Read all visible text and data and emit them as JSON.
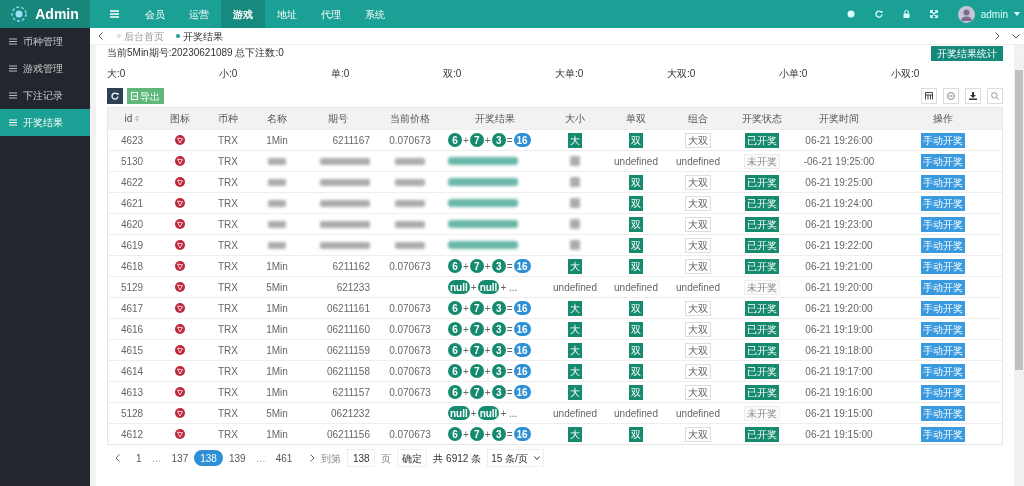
{
  "brand": "Admin",
  "nav": [
    {
      "label": "会员",
      "selected": false
    },
    {
      "label": "运营",
      "selected": false
    },
    {
      "label": "游戏",
      "selected": true
    },
    {
      "label": "地址",
      "selected": false
    },
    {
      "label": "代理",
      "selected": false
    },
    {
      "label": "系统",
      "selected": false
    }
  ],
  "user": "admin",
  "sidebar": [
    {
      "label": "币种管理",
      "selected": false
    },
    {
      "label": "游戏管理",
      "selected": false
    },
    {
      "label": "下注记录",
      "selected": false
    },
    {
      "label": "开奖结果",
      "selected": true
    }
  ],
  "tabs": [
    {
      "label": "后台首页",
      "selected": false
    },
    {
      "label": "开奖结果",
      "selected": true
    }
  ],
  "info": "当前5Min期号:20230621089 总下注数:0",
  "top_button": "开奖结果统计",
  "stats": [
    "大:0",
    "小:0",
    "单:0",
    "双:0",
    "大单:0",
    "大双:0",
    "小单:0",
    "小双:0"
  ],
  "export_button": "导出",
  "table": {
    "columns": [
      "id",
      "图标",
      "币种",
      "名称",
      "期号",
      "当前价格",
      "开奖结果",
      "大小",
      "单双",
      "组合",
      "开奖状态",
      "开奖时间",
      "操作"
    ],
    "rows": [
      {
        "kind": "drawn",
        "id": "4623",
        "coin": "TRX",
        "name": "1Min",
        "period": "6211167",
        "price": "0.070673",
        "result": [
          {
            "kind": "ball",
            "t": "6"
          },
          {
            "kind": "op",
            "t": "+"
          },
          {
            "kind": "ball",
            "t": "7"
          },
          {
            "kind": "op",
            "t": "+"
          },
          {
            "kind": "ball",
            "t": "3"
          },
          {
            "kind": "op",
            "t": "="
          },
          {
            "kind": "sum",
            "t": "16"
          }
        ],
        "size": "大",
        "parity": "双",
        "combo": "大双",
        "status": "已开奖",
        "time": "06-21 19:26:00",
        "action": "手动开奖"
      },
      {
        "kind": "pending",
        "redacted": true,
        "id": "5130",
        "coin": "TRX",
        "parity": "undefined",
        "combo": "undefined",
        "status": "未开奖",
        "time": "-06-21 19:25:00",
        "action": "手动开奖"
      },
      {
        "kind": "drawn",
        "redacted": true,
        "id": "4622",
        "coin": "TRX",
        "parity": "双",
        "combo": "大双",
        "status": "已开奖",
        "time": "06-21 19:25:00",
        "action": "手动开奖"
      },
      {
        "kind": "drawn",
        "redacted": true,
        "id": "4621",
        "coin": "TRX",
        "parity": "双",
        "combo": "大双",
        "status": "已开奖",
        "time": "06-21 19:24:00",
        "action": "手动开奖"
      },
      {
        "kind": "drawn",
        "redacted": true,
        "id": "4620",
        "coin": "TRX",
        "parity": "双",
        "combo": "大双",
        "status": "已开奖",
        "time": "06-21 19:23:00",
        "action": "手动开奖"
      },
      {
        "kind": "drawn",
        "redacted": true,
        "id": "4619",
        "coin": "TRX",
        "parity": "双",
        "combo": "大双",
        "status": "已开奖",
        "time": "06-21 19:22:00",
        "action": "手动开奖"
      },
      {
        "kind": "drawn",
        "id": "4618",
        "coin": "TRX",
        "name": "1Min",
        "period": "6211162",
        "price": "0.070673",
        "result": [
          {
            "kind": "ball",
            "t": "6"
          },
          {
            "kind": "op",
            "t": "+"
          },
          {
            "kind": "ball",
            "t": "7"
          },
          {
            "kind": "op",
            "t": "+"
          },
          {
            "kind": "ball",
            "t": "3"
          },
          {
            "kind": "op",
            "t": "="
          },
          {
            "kind": "sum",
            "t": "16"
          }
        ],
        "size": "大",
        "parity": "双",
        "combo": "大双",
        "status": "已开奖",
        "time": "06-21 19:21:00",
        "action": "手动开奖"
      },
      {
        "kind": "pending",
        "id": "5129",
        "coin": "TRX",
        "name": "5Min",
        "period": "621233",
        "result": [
          {
            "kind": "ball",
            "t": "null"
          },
          {
            "kind": "op",
            "t": "+"
          },
          {
            "kind": "ball",
            "t": "null"
          },
          {
            "kind": "op",
            "t": "+ ..."
          }
        ],
        "size": "undefined",
        "parity": "undefined",
        "combo": "undefined",
        "status": "未开奖",
        "time": "06-21 19:20:00",
        "action": "手动开奖"
      },
      {
        "kind": "drawn",
        "id": "4617",
        "coin": "TRX",
        "name": "1Min",
        "period": "06211161",
        "price": "0.070673",
        "result": [
          {
            "kind": "ball",
            "t": "6"
          },
          {
            "kind": "op",
            "t": "+"
          },
          {
            "kind": "ball",
            "t": "7"
          },
          {
            "kind": "op",
            "t": "+"
          },
          {
            "kind": "ball",
            "t": "3"
          },
          {
            "kind": "op",
            "t": "="
          },
          {
            "kind": "sum",
            "t": "16"
          }
        ],
        "size": "大",
        "parity": "双",
        "combo": "大双",
        "status": "已开奖",
        "time": "06-21 19:20:00",
        "action": "手动开奖"
      },
      {
        "kind": "drawn",
        "id": "4616",
        "coin": "TRX",
        "name": "1Min",
        "period": "06211160",
        "price": "0.070673",
        "result": [
          {
            "kind": "ball",
            "t": "6"
          },
          {
            "kind": "op",
            "t": "+"
          },
          {
            "kind": "ball",
            "t": "7"
          },
          {
            "kind": "op",
            "t": "+"
          },
          {
            "kind": "ball",
            "t": "3"
          },
          {
            "kind": "op",
            "t": "="
          },
          {
            "kind": "sum",
            "t": "16"
          }
        ],
        "size": "大",
        "parity": "双",
        "combo": "大双",
        "status": "已开奖",
        "time": "06-21 19:19:00",
        "action": "手动开奖"
      },
      {
        "kind": "drawn",
        "id": "4615",
        "coin": "TRX",
        "name": "1Min",
        "period": "06211159",
        "price": "0.070673",
        "result": [
          {
            "kind": "ball",
            "t": "6"
          },
          {
            "kind": "op",
            "t": "+"
          },
          {
            "kind": "ball",
            "t": "7"
          },
          {
            "kind": "op",
            "t": "+"
          },
          {
            "kind": "ball",
            "t": "3"
          },
          {
            "kind": "op",
            "t": "="
          },
          {
            "kind": "sum",
            "t": "16"
          }
        ],
        "size": "大",
        "parity": "双",
        "combo": "大双",
        "status": "已开奖",
        "time": "06-21 19:18:00",
        "action": "手动开奖"
      },
      {
        "kind": "drawn",
        "id": "4614",
        "coin": "TRX",
        "name": "1Min",
        "period": "06211158",
        "price": "0.070673",
        "result": [
          {
            "kind": "ball",
            "t": "6"
          },
          {
            "kind": "op",
            "t": "+"
          },
          {
            "kind": "ball",
            "t": "7"
          },
          {
            "kind": "op",
            "t": "+"
          },
          {
            "kind": "ball",
            "t": "3"
          },
          {
            "kind": "op",
            "t": "="
          },
          {
            "kind": "sum",
            "t": "16"
          }
        ],
        "size": "大",
        "parity": "双",
        "combo": "大双",
        "status": "已开奖",
        "time": "06-21 19:17:00",
        "action": "手动开奖"
      },
      {
        "kind": "drawn",
        "id": "4613",
        "coin": "TRX",
        "name": "1Min",
        "period": "6211157",
        "price": "0.070673",
        "result": [
          {
            "kind": "ball",
            "t": "6"
          },
          {
            "kind": "op",
            "t": "+"
          },
          {
            "kind": "ball",
            "t": "7"
          },
          {
            "kind": "op",
            "t": "+"
          },
          {
            "kind": "ball",
            "t": "3"
          },
          {
            "kind": "op",
            "t": "="
          },
          {
            "kind": "sum",
            "t": "16"
          }
        ],
        "size": "大",
        "parity": "双",
        "combo": "大双",
        "status": "已开奖",
        "time": "06-21 19:16:00",
        "action": "手动开奖"
      },
      {
        "kind": "pending",
        "id": "5128",
        "coin": "TRX",
        "name": "5Min",
        "period": "0621232",
        "result": [
          {
            "kind": "ball",
            "t": "null"
          },
          {
            "kind": "op",
            "t": "+"
          },
          {
            "kind": "ball",
            "t": "null"
          },
          {
            "kind": "op",
            "t": "+ ..."
          }
        ],
        "size": "undefined",
        "parity": "undefined",
        "combo": "undefined",
        "status": "未开奖",
        "time": "06-21 19:15:00",
        "action": "手动开奖"
      },
      {
        "kind": "drawn",
        "id": "4612",
        "coin": "TRX",
        "name": "1Min",
        "period": "06211156",
        "price": "0.070673",
        "result": [
          {
            "kind": "ball",
            "t": "6"
          },
          {
            "kind": "op",
            "t": "+"
          },
          {
            "kind": "ball",
            "t": "7"
          },
          {
            "kind": "op",
            "t": "+"
          },
          {
            "kind": "ball",
            "t": "3"
          },
          {
            "kind": "op",
            "t": "="
          },
          {
            "kind": "sum",
            "t": "16"
          }
        ],
        "size": "大",
        "parity": "双",
        "combo": "大双",
        "status": "已开奖",
        "time": "06-21 19:15:00",
        "action": "手动开奖"
      }
    ]
  },
  "pagination": {
    "pages": [
      {
        "label": "1",
        "selected": false
      },
      {
        "label": "…",
        "kind": "gap"
      },
      {
        "label": "137",
        "selected": false
      },
      {
        "label": "138",
        "selected": true
      },
      {
        "label": "139",
        "selected": false
      },
      {
        "label": "…",
        "kind": "gap"
      },
      {
        "label": "461",
        "selected": false
      }
    ],
    "goto_label": "到第",
    "goto_value": "138",
    "page_unit": "页",
    "confirm": "确定",
    "total": "共 6912 条",
    "per_page": "15 条/页"
  }
}
